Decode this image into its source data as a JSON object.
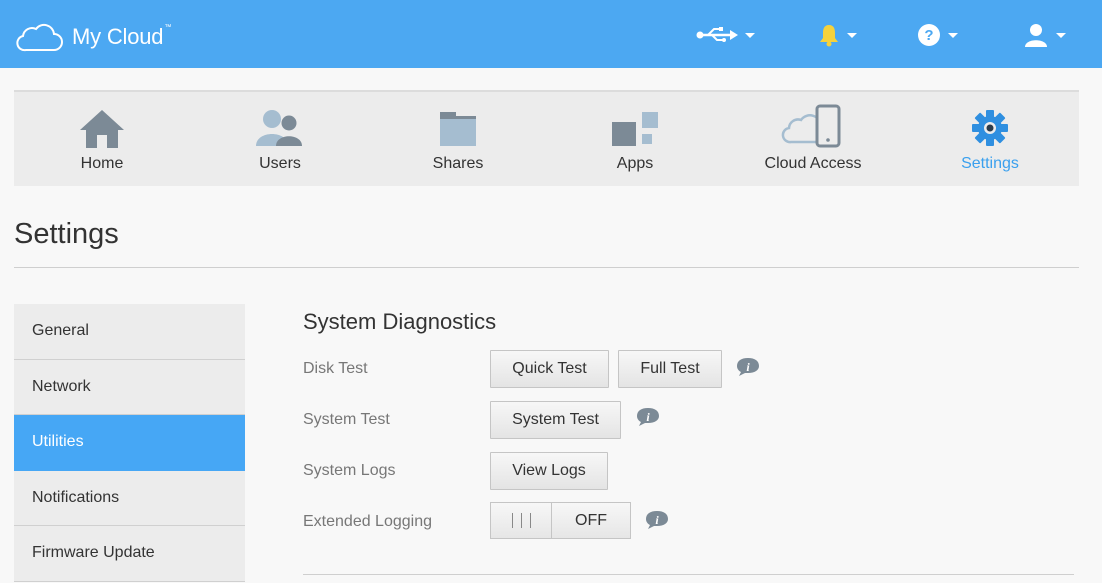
{
  "header": {
    "brand": "My Cloud",
    "trademark": "™",
    "icons": [
      "usb-icon",
      "bell-icon",
      "help-icon",
      "user-icon"
    ],
    "colors": {
      "bar": "#4ca8f2",
      "bell": "#f5d23c"
    }
  },
  "nav": {
    "items": [
      {
        "label": "Home",
        "icon": "home-icon"
      },
      {
        "label": "Users",
        "icon": "users-icon"
      },
      {
        "label": "Shares",
        "icon": "shares-icon"
      },
      {
        "label": "Apps",
        "icon": "apps-icon"
      },
      {
        "label": "Cloud Access",
        "icon": "cloud-access-icon"
      },
      {
        "label": "Settings",
        "icon": "settings-gear-icon",
        "active": true
      }
    ]
  },
  "page": {
    "title": "Settings"
  },
  "sidebar": {
    "items": [
      {
        "label": "General"
      },
      {
        "label": "Network"
      },
      {
        "label": "Utilities",
        "active": true
      },
      {
        "label": "Notifications"
      },
      {
        "label": "Firmware Update"
      }
    ]
  },
  "content": {
    "section_title": "System Diagnostics",
    "disk_test": {
      "label": "Disk Test",
      "quick": "Quick Test",
      "full": "Full Test"
    },
    "system_test": {
      "label": "System Test",
      "button": "System Test"
    },
    "system_logs": {
      "label": "System Logs",
      "button": "View Logs"
    },
    "extended_logging": {
      "label": "Extended Logging",
      "state": "OFF"
    }
  }
}
